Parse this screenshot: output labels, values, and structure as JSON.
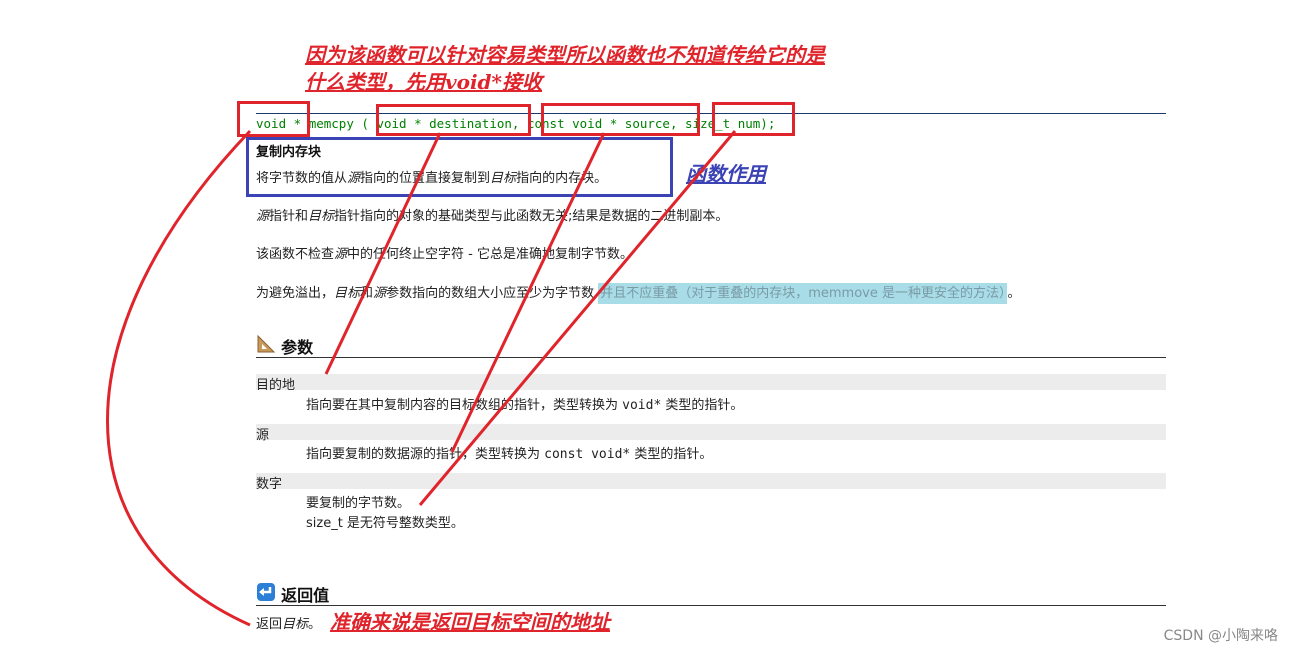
{
  "annotation_top": {
    "line1": "因为该函数可以针对容易类型所以函数也不知道传给它的是",
    "line2": "什么类型，先用void*接收"
  },
  "signature": {
    "ret": "void *",
    "name": "memcpy",
    "open": "(",
    "param1": "void * destination",
    "comma1": ",",
    "param2": "const void * source",
    "comma2": ",",
    "param3": "size_t num",
    "close": ");"
  },
  "summary": {
    "heading": "复制内存块",
    "text_a": "将字节数的值从",
    "text_src": "源",
    "text_b": "指向的位置直接复制到",
    "text_dst": "目标",
    "text_c": "指向的内存块。"
  },
  "function_annotation": "函数作用",
  "paragraphs": {
    "p1_src": "源",
    "p1_a": "指针和",
    "p1_dst": "目标",
    "p1_b": "指针指向的对象的基础类型与此函数无关;结果是数据的二进制副本。",
    "p2_a": "该函数不检查",
    "p2_src": "源",
    "p2_b": "中的任何终止空字符 - 它总是准确地复制字节数。",
    "p3_a": "为避免溢出，",
    "p3_dst": "目标",
    "p3_b": "和",
    "p3_src": "源",
    "p3_c": "参数指向的数组大小应至少为字节数,",
    "p3_highlight": "并且不应重叠（对于重叠的内存块，memmove 是一种更安全的方法）",
    "p3_end": "。"
  },
  "params_section": {
    "title": "参数",
    "items": [
      {
        "name": "目的地",
        "desc_a": "指向要在其中复制内容的目标数组的指针，类型转换为 ",
        "desc_code": "void*",
        "desc_b": " 类型的指针。"
      },
      {
        "name": "源",
        "desc_a": "指向要复制的数据源的指针，类型转换为 ",
        "desc_code": "const void*",
        "desc_b": " 类型的指针。"
      },
      {
        "name": "数字",
        "desc_a": "要复制的字节数。",
        "desc_code": "",
        "desc_b": "",
        "desc_c": "size_t 是无符号整数类型。"
      }
    ]
  },
  "return_section": {
    "title": "返回值",
    "text_a": "返回",
    "text_dst": "目标",
    "text_b": "。"
  },
  "return_annotation": "准确来说是返回目标空间的地址",
  "watermark": "CSDN @小陶来咯",
  "colors": {
    "annotation_red": "#e0242b",
    "annotation_blue": "#3b43b5",
    "code_green": "#008000",
    "highlight": "#a8dce6",
    "link_blue": "#1f4fa0"
  },
  "icons": {
    "params": "triangle-ruler-icon",
    "return": "return-arrow-icon"
  }
}
